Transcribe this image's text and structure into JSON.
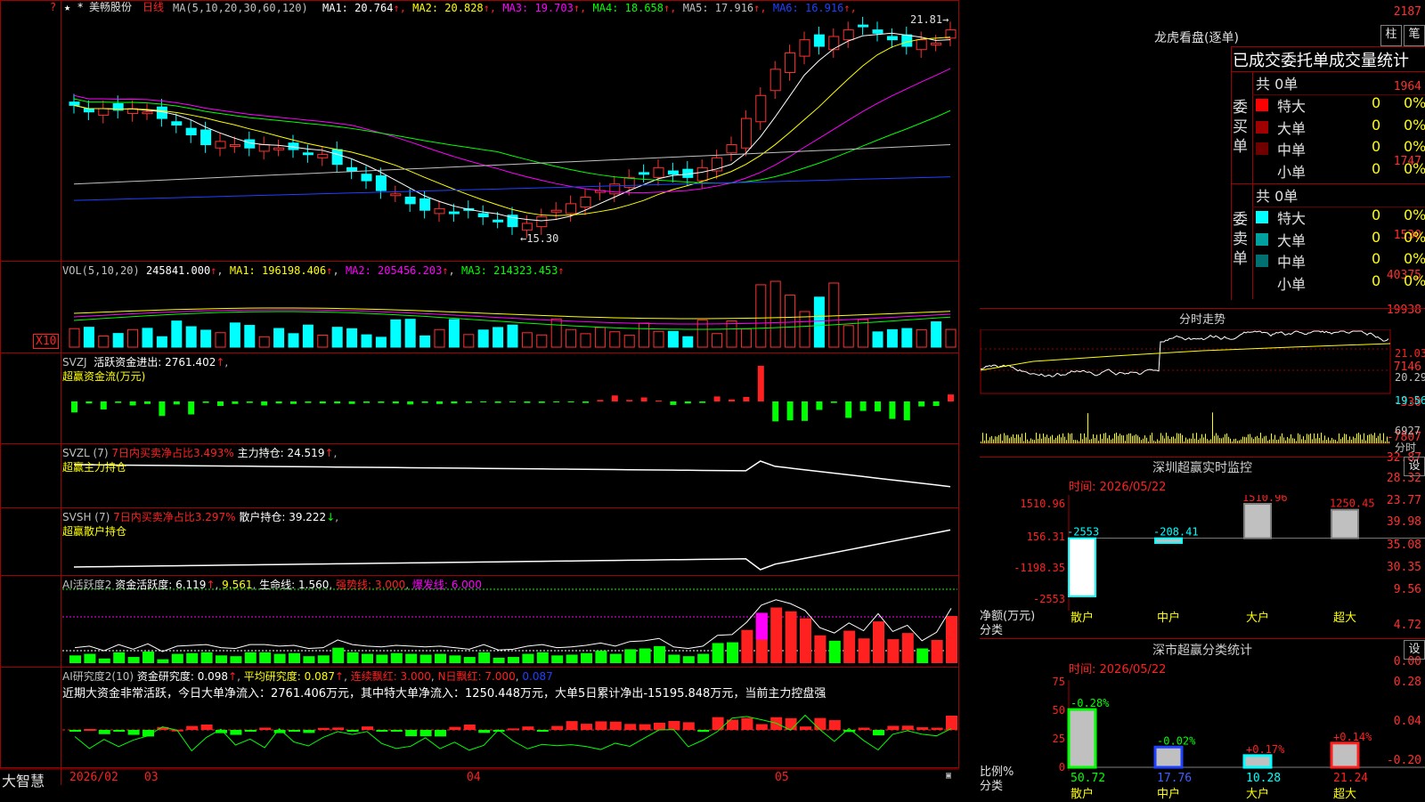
{
  "stock": {
    "name": "美畅股份",
    "period": "日线"
  },
  "main_header": {
    "ma_params": "MA(5,10,20,30,60,120)",
    "ma_items": [
      {
        "label": "MA1: 20.764",
        "color": "#ffffff"
      },
      {
        "label": "MA2: 20.828",
        "color": "#ffff00"
      },
      {
        "label": "MA3: 19.703",
        "color": "#ff00ff"
      },
      {
        "label": "MA4: 18.658",
        "color": "#00ff00"
      },
      {
        "label": "MA5: 17.916",
        "color": "#c0c0c0"
      },
      {
        "label": "MA6: 16.916",
        "color": "#2040ff"
      }
    ],
    "high_marker": "21.81",
    "low_marker": "15.30"
  },
  "axes": {
    "price": [
      "2187",
      "1964",
      "1747",
      "1530"
    ],
    "vol": [
      "40375",
      "19938"
    ],
    "vol_unit": "X10",
    "svzj": [
      "7146",
      "-330",
      "-7807"
    ],
    "svzl": [
      "32.87",
      "28.32",
      "23.77"
    ],
    "svsh": [
      "39.98",
      "35.08",
      "30.35"
    ],
    "ai1": [
      "9.56",
      "4.72",
      "0.00"
    ],
    "ai2": [
      "0.28",
      "0.04",
      "-0.20"
    ],
    "dates": [
      "2026/02",
      "03",
      "04",
      "05"
    ]
  },
  "vol_header": {
    "params": "VOL(5,10,20)",
    "value": "245841.000",
    "ma1": "MA1: 196198.406",
    "ma2": "MA2: 205456.203",
    "ma3": "MA3: 214323.453"
  },
  "svzj_header": {
    "name": "SVZJ",
    "label": "活跃资金进出: 2761.402",
    "sub": "超赢资金流(万元)"
  },
  "svzl_header": {
    "name": "SVZL (7)",
    "ratio": "7日内买卖净占比3.493%",
    "label": "主力持仓: 24.519",
    "sub": "超赢主力持仓"
  },
  "svsh_header": {
    "name": "SVSH (7)",
    "ratio": "7日内买卖净占比3.297%",
    "label": "散户持仓: 39.222",
    "sub": "超赢散户持仓"
  },
  "ai1_header": {
    "name": "AI活跃度2",
    "a": "资金活跃度: 6.119",
    "b": "9.561",
    "c": "生命线: 1.560",
    "d": "强势线: 3.000",
    "e": "爆发线: 6.000"
  },
  "ai2_header": {
    "name": "AI研究度2(10)",
    "a": "资金研究度: 0.098",
    "b": "平均研究度: 0.087",
    "c": "连续飘红: 3.000",
    "d": "N日飘红: 7.000",
    "e": "0.087",
    "summary": "近期大资金非常活跃，今日大单净流入：2761.406万元，其中特大单净流入：1250.448万元，大单5日累计净出-15195.848万元，当前主力控盘强"
  },
  "footer": {
    "brand": "大智慧"
  },
  "right": {
    "longhu_title": "龙虎看盘(逐单)",
    "btn_bar": "柱",
    "btn_stroke": "笔",
    "table_title": "已成交委托单成交量统计",
    "buy_label": "委买单",
    "sell_label": "委卖单",
    "buy_total": "共 0单",
    "sell_total": "共 0单",
    "buy_rows": [
      {
        "label": "特大",
        "count": "0",
        "pct": "0%",
        "color": "#ff0000"
      },
      {
        "label": "大单",
        "count": "0",
        "pct": "0%",
        "color": "#a00000"
      },
      {
        "label": "中单",
        "count": "0",
        "pct": "0%",
        "color": "#700000"
      },
      {
        "label": "小单",
        "count": "0",
        "pct": "0%",
        "color": "#000000"
      }
    ],
    "sell_rows": [
      {
        "label": "特大",
        "count": "0",
        "pct": "0%",
        "color": "#00ffff"
      },
      {
        "label": "大单",
        "count": "0",
        "pct": "0%",
        "color": "#00a0a0"
      },
      {
        "label": "中单",
        "count": "0",
        "pct": "0%",
        "color": "#007070"
      },
      {
        "label": "小单",
        "count": "0",
        "pct": "0%",
        "color": "#000000"
      }
    ],
    "intraday_title": "分时走势",
    "intraday_axis": [
      "21.03",
      "20.29",
      "19.56",
      "6927"
    ],
    "intraday_unit": "分时",
    "monitor_title": "深圳超赢实时监控",
    "settings_label": "设",
    "monitor_time": "时间: 2026/05/22",
    "monitor_yaxis": [
      "1510.96",
      "156.31",
      "-1198.35",
      "-2553"
    ],
    "monitor_ylabel": "净额(万元)",
    "monitor_xlabel": "分类",
    "classify_title": "深市超赢分类统计",
    "classify_time": "时间: 2026/05/22",
    "classify_yaxis": [
      "75",
      "50",
      "25",
      "0"
    ],
    "classify_ylabel": "比例%",
    "classify_xlabel": "分类"
  },
  "chart_data": [
    {
      "type": "bar",
      "title": "深圳超赢实时监控",
      "ylabel": "净额(万元)",
      "categories": [
        "散户",
        "中户",
        "大户",
        "超大"
      ],
      "values": [
        -2553,
        -208.41,
        1510.96,
        1250.45
      ],
      "value_labels": [
        "-2553",
        "-208.41",
        "1510.96",
        "1250.45"
      ],
      "ylim": [
        -2553,
        1510.96
      ]
    },
    {
      "type": "bar",
      "title": "深市超赢分类统计",
      "ylabel": "比例%",
      "categories": [
        "散户",
        "中户",
        "大户",
        "超大"
      ],
      "values": [
        50.72,
        17.76,
        10.28,
        21.24
      ],
      "changes": [
        "-0.28%",
        "-0.02%",
        "+0.17%",
        "+0.14%"
      ],
      "colors": [
        "#00ff00",
        "#2040ff",
        "#00ffff",
        "#ff2020"
      ],
      "ylim": [
        0,
        75
      ]
    },
    {
      "type": "bar",
      "title": "超赢资金流(万元)",
      "values": [
        -2200,
        -400,
        -1600,
        -300,
        -800,
        -500,
        -2900,
        -600,
        -2600,
        -300,
        -900,
        -500,
        -300,
        -800,
        -400,
        -500,
        -300,
        -400,
        -400,
        -500,
        -300,
        -300,
        -400,
        -600,
        -300,
        -500,
        -400,
        -300,
        -200,
        -300,
        -200,
        -300,
        -300,
        -200,
        -200,
        -300,
        300,
        1200,
        300,
        800,
        200,
        -700,
        -400,
        -300,
        1000,
        400,
        900,
        7146,
        -4000,
        -3800,
        -3900,
        -1700,
        -300,
        -3300,
        -1900,
        -2000,
        -3500,
        -3800,
        -1000,
        -900,
        1400
      ]
    },
    {
      "type": "bar",
      "title": "AI活跃度2",
      "values": [
        1.0,
        1.2,
        0.6,
        1.4,
        0.8,
        1.5,
        0.5,
        1.2,
        1.3,
        1.4,
        1.0,
        0.9,
        1.4,
        1.4,
        1.2,
        1.3,
        0.9,
        1.0,
        2.0,
        1.4,
        1.2,
        1.1,
        1.3,
        1.2,
        1.1,
        1.2,
        1.0,
        0.8,
        1.4,
        0.7,
        0.8,
        1.2,
        1.4,
        1.0,
        1.1,
        1.3,
        1.6,
        1.2,
        1.8,
        1.9,
        2.2,
        1.1,
        0.9,
        1.2,
        2.6,
        2.7,
        4.3,
        6.5,
        7.2,
        6.7,
        5.8,
        3.6,
        2.9,
        4.2,
        3.2,
        5.4,
        3.1,
        3.9,
        1.9,
        3.0,
        6.1
      ]
    }
  ]
}
